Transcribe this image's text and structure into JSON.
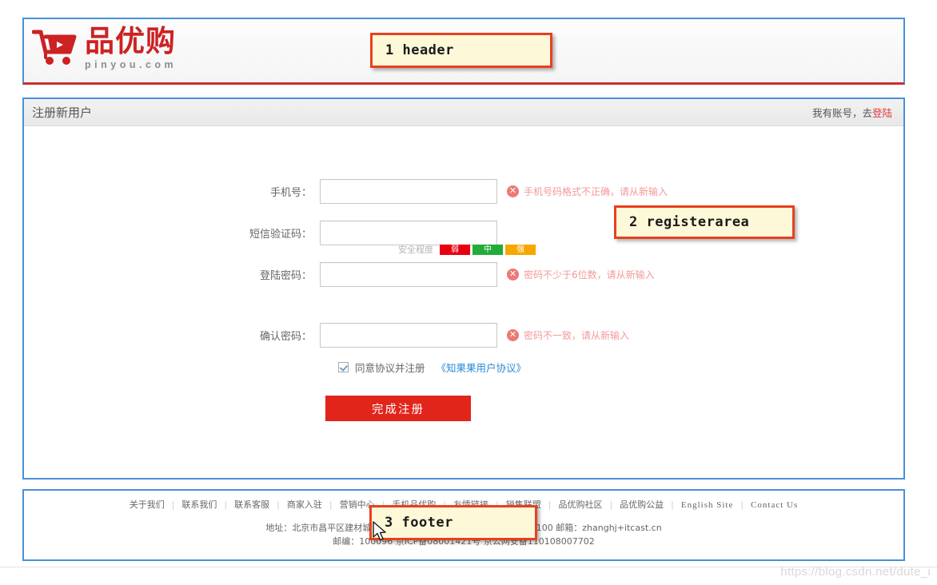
{
  "header": {
    "logo_cn": "品优购",
    "logo_en": "pinyou.com",
    "cart_icon": "shopping-cart-icon"
  },
  "register": {
    "title": "注册新用户",
    "login_hint_prefix": "我有账号，去",
    "login_link": "登陆",
    "fields": [
      {
        "label": "手机号：",
        "value": "",
        "placeholder": "",
        "error": "手机号码格式不正确，请从新输入"
      },
      {
        "label": "短信验证码：",
        "value": "",
        "placeholder": "",
        "error": ""
      },
      {
        "label": "登陆密码：",
        "value": "",
        "placeholder": "",
        "error": "密码不少于6位数，请从新输入"
      },
      {
        "label": "确认密码：",
        "value": "",
        "placeholder": "",
        "error": "密码不一致，请从新输入"
      }
    ],
    "strength": {
      "label": "安全程度",
      "segments": [
        {
          "text": "弱",
          "color": "#e60012"
        },
        {
          "text": "中",
          "color": "#22ac38"
        },
        {
          "text": "强",
          "color": "#f7a700"
        }
      ]
    },
    "agreement": {
      "checked": true,
      "text": "同意协议并注册",
      "link": "《知果果用户协议》"
    },
    "submit_label": "完成注册"
  },
  "footer": {
    "links": [
      "关于我们",
      "联系我们",
      "联系客服",
      "商家入驻",
      "营销中心",
      "手机品优购",
      "友情链接",
      "销售联盟",
      "品优购社区",
      "品优购公益",
      "English Site",
      "Contact Us"
    ],
    "separator": "|",
    "address_line1": "地址：北京市昌平区建材城西路金燕龙办公楼一层    电话：010-82935100    邮箱：zhanghj+itcast.cn",
    "address_line2": "邮编：100096    京ICP备08001421号  京公网安备110108007702"
  },
  "annotations": [
    {
      "id": "1",
      "label": "1  header"
    },
    {
      "id": "2",
      "label": "2  registerarea"
    },
    {
      "id": "3",
      "label": "3  footer"
    }
  ],
  "watermark": "https://blog.csdn.net/dute_i",
  "colors": {
    "brand_red": "#cc2222",
    "button_red": "#e1251b",
    "section_border_blue": "#4a90d9",
    "callout_border": "#e8401f",
    "callout_bg": "#fcf8d8",
    "error_text": "#f07c7c",
    "link_blue": "#2b8ad8"
  }
}
